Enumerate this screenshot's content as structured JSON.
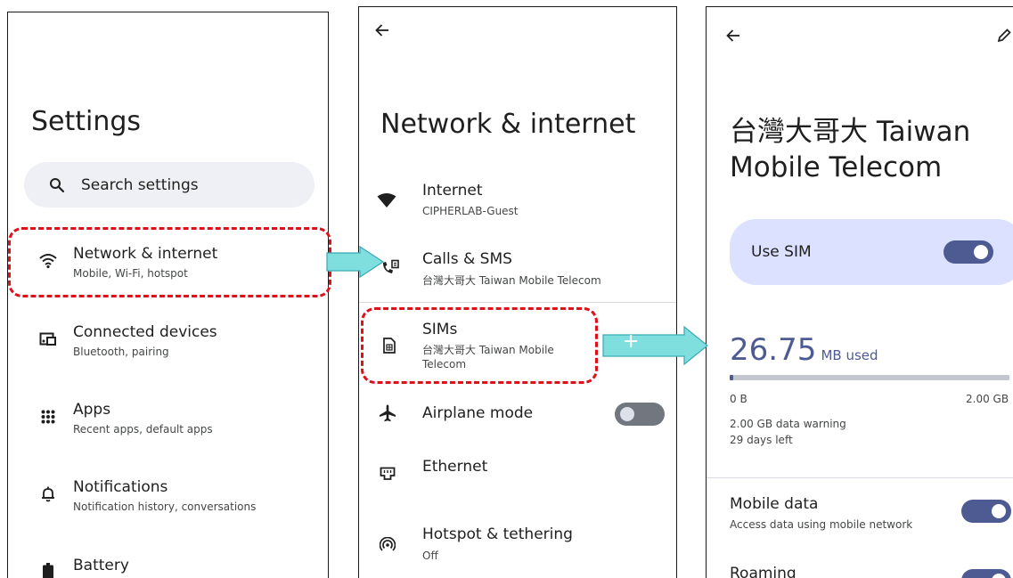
{
  "colors": {
    "accent": "#4e5b92",
    "highlight": "#e0101a",
    "arrow": "#7fdede",
    "sim_card_bg": "#dbe1ff"
  },
  "settings": {
    "title": "Settings",
    "search_placeholder": "Search settings",
    "items": [
      {
        "title": "Network & internet",
        "subtitle": "Mobile, Wi-Fi, hotspot",
        "icon": "wifi-icon"
      },
      {
        "title": "Connected devices",
        "subtitle": "Bluetooth, pairing",
        "icon": "connected-devices-icon"
      },
      {
        "title": "Apps",
        "subtitle": "Recent apps, default apps",
        "icon": "apps-grid-icon"
      },
      {
        "title": "Notifications",
        "subtitle": "Notification history, conversations",
        "icon": "bell-icon"
      },
      {
        "title": "Battery",
        "icon": "battery-icon"
      }
    ]
  },
  "network": {
    "title": "Network & internet",
    "items": [
      {
        "title": "Internet",
        "subtitle": "CIPHERLAB-Guest",
        "icon": "wifi-filled-icon"
      },
      {
        "title": "Calls & SMS",
        "subtitle": "台灣大哥大 Taiwan Mobile Telecom",
        "icon": "calls-sms-icon"
      },
      {
        "title": "SIMs",
        "subtitle_line1": "台灣大哥大 Taiwan Mobile",
        "subtitle_line2": "Telecom",
        "action": "+",
        "icon": "sim-card-icon"
      },
      {
        "title": "Airplane mode",
        "toggle": "off",
        "icon": "airplane-icon"
      },
      {
        "title": "Ethernet",
        "icon": "ethernet-icon"
      },
      {
        "title": "Hotspot & tethering",
        "subtitle": "Off",
        "icon": "hotspot-icon"
      }
    ]
  },
  "sim": {
    "title_line1": "台灣大哥大 Taiwan",
    "title_line2": "Mobile Telecom",
    "use_sim_label": "Use SIM",
    "use_sim_toggle": "on",
    "usage_value": "26.75",
    "usage_unit": "MB used",
    "usage_fraction": 0.013,
    "range_min": "0 B",
    "range_max": "2.00 GB",
    "data_warning": "2.00 GB data warning",
    "days_left": "29 days left",
    "mobile_data_title": "Mobile data",
    "mobile_data_subtitle": "Access data using mobile network",
    "mobile_data_toggle": "on",
    "roaming_title": "Roaming",
    "roaming_toggle": "on"
  }
}
